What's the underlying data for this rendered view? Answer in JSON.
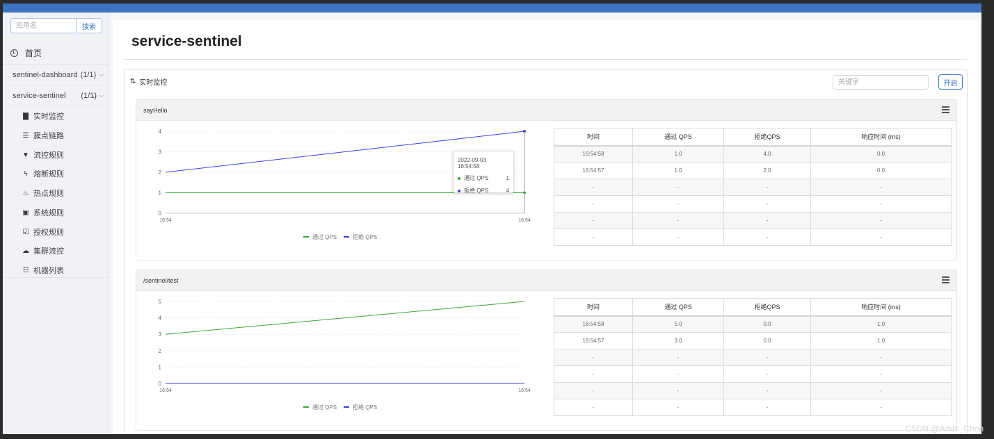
{
  "sidebar": {
    "search_placeholder": "应用名",
    "search_button": "搜索",
    "home_label": "首页",
    "apps": [
      {
        "name": "sentinel-dashboard",
        "count": "(1/1)"
      },
      {
        "name": "service-sentinel",
        "count": "(1/1)"
      }
    ],
    "items": [
      {
        "label": "实时监控",
        "icon": "bar-chart-icon"
      },
      {
        "label": "簇点链路",
        "icon": "list-icon"
      },
      {
        "label": "流控规则",
        "icon": "filter-icon"
      },
      {
        "label": "熔断规则",
        "icon": "flash-icon"
      },
      {
        "label": "热点规则",
        "icon": "fire-icon"
      },
      {
        "label": "系统规则",
        "icon": "lock-icon"
      },
      {
        "label": "授权规则",
        "icon": "check-icon"
      },
      {
        "label": "集群流控",
        "icon": "cloud-icon"
      },
      {
        "label": "机器列表",
        "icon": "th-list-icon"
      }
    ]
  },
  "main": {
    "title": "service-sentinel",
    "monitor_title": "实时监控",
    "keyword_placeholder": "关键字",
    "stop_button": "开启",
    "table_headers": [
      "时间",
      "通过 QPS",
      "拒绝QPS",
      "响应时间 (ms)"
    ],
    "legend": [
      "通过 QPS",
      "拒绝 QPS"
    ],
    "resources": [
      {
        "name": "sayHello",
        "rows": [
          [
            "16:54:58",
            "1.0",
            "4.0",
            "0.0"
          ],
          [
            "16:54:57",
            "1.0",
            "2.0",
            "0.0"
          ],
          [
            "-",
            "-",
            "-",
            "-"
          ],
          [
            "-",
            "-",
            "-",
            "-"
          ],
          [
            "-",
            "-",
            "-",
            "-"
          ],
          [
            "-",
            "-",
            "-",
            "-"
          ]
        ],
        "tooltip": {
          "time": "2022-09-03 16:54:58",
          "pass_label": "通过 QPS",
          "pass_value": "1",
          "block_label": "拒绝 QPS",
          "block_value": "4"
        }
      },
      {
        "name": "/sentinel/test",
        "rows": [
          [
            "16:54:58",
            "5.0",
            "0.0",
            "1.0"
          ],
          [
            "16:54:57",
            "3.0",
            "0.0",
            "1.0"
          ],
          [
            "-",
            "-",
            "-",
            "-"
          ],
          [
            "-",
            "-",
            "-",
            "-"
          ],
          [
            "-",
            "-",
            "-",
            "-"
          ],
          [
            "-",
            "-",
            "-",
            "-"
          ]
        ]
      }
    ]
  },
  "watermark": "CSDN @Adda_Chen",
  "colors": {
    "pass": "#3aa63a",
    "block": "#3d3de6",
    "accent": "#3c74c0"
  },
  "chart_data": [
    {
      "type": "line",
      "x": [
        "16:54",
        "16:54"
      ],
      "ylim": [
        0,
        4
      ],
      "yticks": [
        0,
        1,
        2,
        3,
        4
      ],
      "series": [
        {
          "name": "通过 QPS",
          "values": [
            1,
            1
          ]
        },
        {
          "name": "拒绝 QPS",
          "values": [
            2,
            4
          ]
        }
      ]
    },
    {
      "type": "line",
      "x": [
        "16:54",
        "16:54"
      ],
      "ylim": [
        0,
        5
      ],
      "yticks": [
        0,
        1,
        2,
        3,
        4,
        5
      ],
      "series": [
        {
          "name": "通过 QPS",
          "values": [
            3,
            5
          ]
        },
        {
          "name": "拒绝 QPS",
          "values": [
            0,
            0
          ]
        }
      ]
    }
  ]
}
